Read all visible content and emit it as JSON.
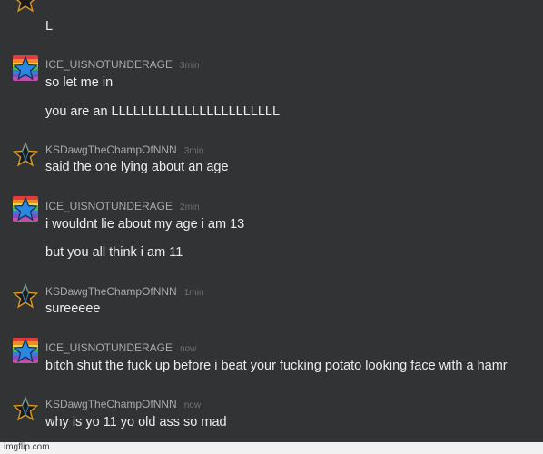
{
  "messages": [
    {
      "username": "",
      "time": "",
      "avatar": "star-icon",
      "lines": [
        "L"
      ]
    },
    {
      "username": "ICE_UISNOTUNDERAGE",
      "time": "3min",
      "avatar": "rainbow-star-icon",
      "lines": [
        "so let me in",
        "you are an LLLLLLLLLLLLLLLLLLLLLLL"
      ]
    },
    {
      "username": "KSDawgTheChampOfNNN",
      "time": "3min",
      "avatar": "star-icon",
      "lines": [
        "said the one lying about an age"
      ]
    },
    {
      "username": "ICE_UISNOTUNDERAGE",
      "time": "2min",
      "avatar": "rainbow-star-icon",
      "lines": [
        "i wouldnt lie about my age i am 13",
        "but you all think i am 11"
      ]
    },
    {
      "username": "KSDawgTheChampOfNNN",
      "time": "1min",
      "avatar": "star-icon",
      "lines": [
        "sureeeee"
      ]
    },
    {
      "username": "ICE_UISNOTUNDERAGE",
      "time": "now",
      "avatar": "rainbow-star-icon",
      "lines": [
        "bitch shut the fuck up before i beat your fucking potato looking face with a hamr"
      ]
    },
    {
      "username": "KSDawgTheChampOfNNN",
      "time": "now",
      "avatar": "star-icon",
      "lines": [
        "why is yo 11 yo old ass so mad"
      ]
    }
  ],
  "watermark": "imgflip.com",
  "colors": {
    "background": "#323335",
    "text": "#ececec",
    "username": "#a9a9a9",
    "timestamp": "#6f7073"
  }
}
